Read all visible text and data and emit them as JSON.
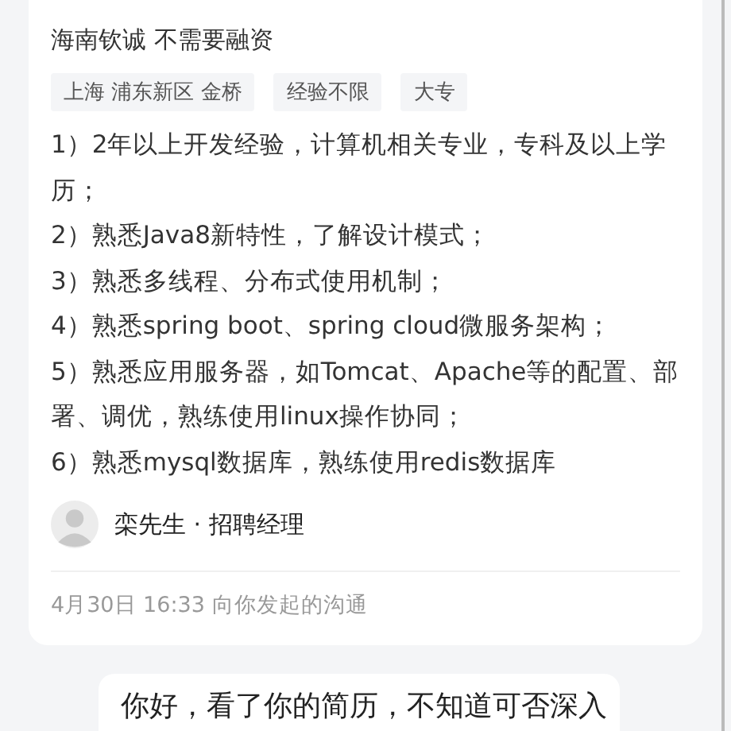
{
  "job_card": {
    "company": "海南钦诚 不需要融资",
    "tags": [
      "上海 浦东新区 金桥",
      "经验不限",
      "大专"
    ],
    "requirements": [
      "1）2年以上开发经验，计算机相关专业，专科及以上学历；",
      "2）熟悉Java8新特性，了解设计模式；",
      "3）熟悉多线程、分布式使用机制；",
      "4）熟悉spring boot、spring cloud微服务架构；",
      "5）熟悉应用服务器，如Tomcat、Apache等的配置、部署、调优，熟练使用linux操作协同；",
      "6）熟悉mysql数据库，熟练使用redis数据库"
    ],
    "recruiter": "栾先生 · 招聘经理",
    "timestamp": "4月30日 16:33 向你发起的沟通"
  },
  "message": {
    "text": "你好，看了你的简历，不知道可否深入"
  }
}
